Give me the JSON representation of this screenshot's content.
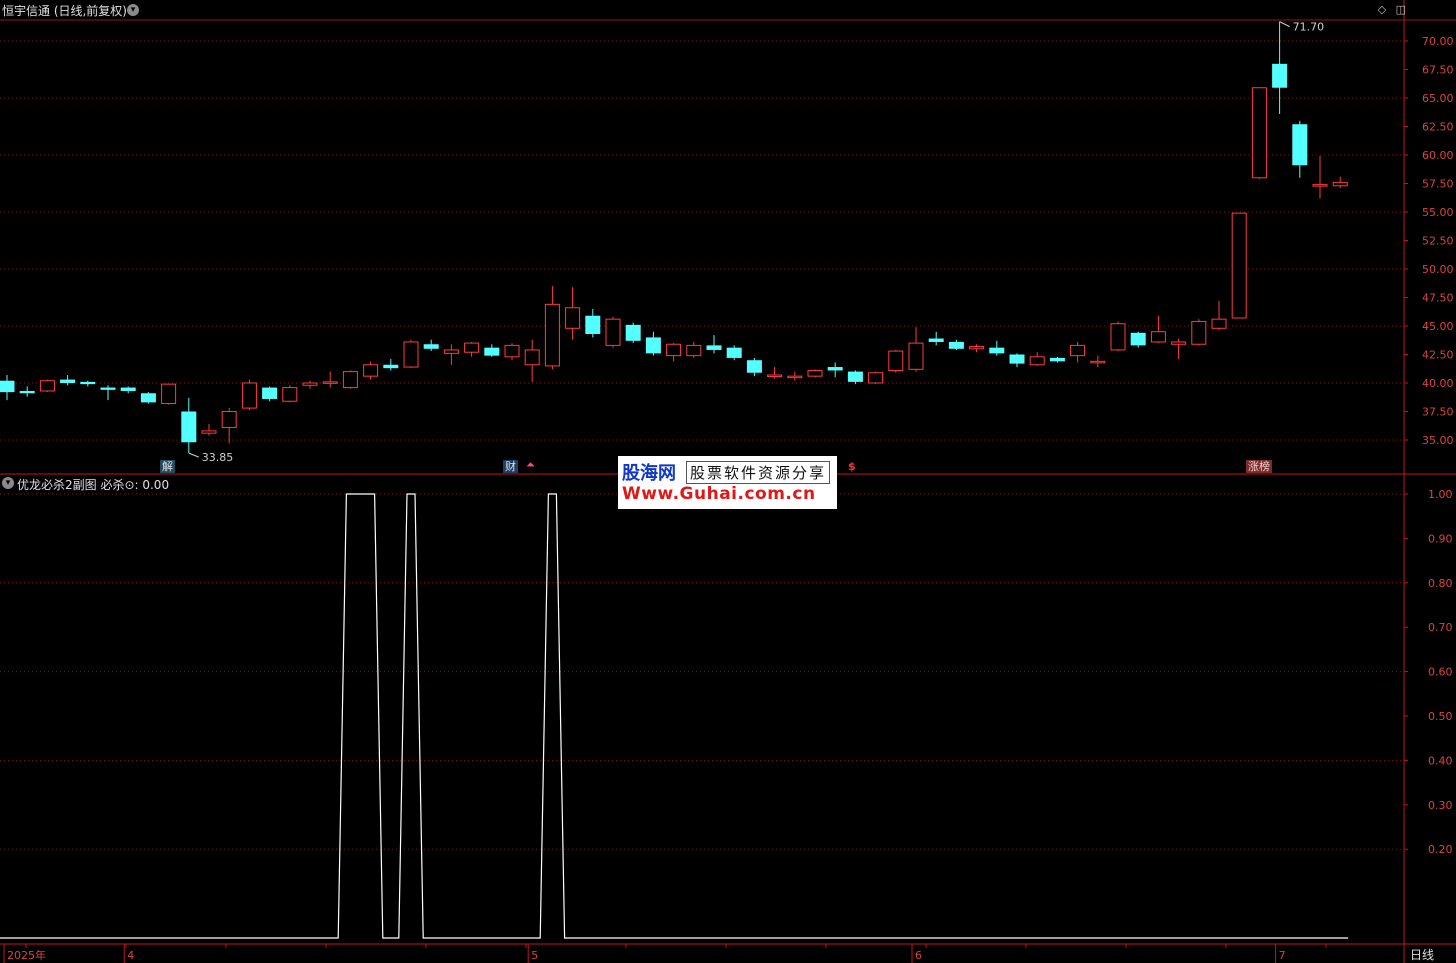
{
  "header": {
    "title": "恒宇信通 (日线,前复权)",
    "dropdown_icon": "chevron-down-icon",
    "window_icons": [
      "◇",
      "◫"
    ]
  },
  "sub_header": {
    "title": "优龙必杀2副图 必杀⊙: 0.00"
  },
  "markers": {
    "jie": "解",
    "cai": "财",
    "up": "⏶",
    "dollar": "$",
    "zhangbang": "涨榜"
  },
  "logo": {
    "line1_cn": "股海网",
    "line1_tag": "股票软件资源分享",
    "line2": "Www.Guhai.com.cn"
  },
  "annotations": {
    "high": "71.70",
    "low": "33.85"
  },
  "price_axis": [
    "70.00",
    "67.50",
    "65.00",
    "62.50",
    "60.00",
    "57.50",
    "55.00",
    "52.50",
    "50.00",
    "47.50",
    "45.00",
    "42.50",
    "40.00",
    "37.50",
    "35.00"
  ],
  "indicator_axis": [
    "1.00",
    "0.90",
    "0.80",
    "0.70",
    "0.60",
    "0.50",
    "0.40",
    "0.30",
    "0.20"
  ],
  "date_axis": [
    {
      "label": "2025年",
      "index": 0
    },
    {
      "label": "4",
      "index": 6
    },
    {
      "label": "5",
      "index": 26
    },
    {
      "label": "6",
      "index": 45
    },
    {
      "label": "7",
      "index": 63
    }
  ],
  "bottom_tab": "日线",
  "colors": {
    "up": "#ff3c3c",
    "down": "#54ffff",
    "grid": "#8a1010",
    "line": "#ffffff"
  },
  "chart_data": {
    "type": "candlestick",
    "price_range": [
      32.5,
      72.0
    ],
    "indicator_range": [
      0.0,
      1.0
    ],
    "candles": [
      [
        40.2,
        39.2,
        40.7,
        38.5
      ],
      [
        39.3,
        39.1,
        39.7,
        38.8
      ],
      [
        39.3,
        40.2,
        40.3,
        39.2
      ],
      [
        40.3,
        40.0,
        40.7,
        39.8
      ],
      [
        40.1,
        39.9,
        40.2,
        39.7
      ],
      [
        39.6,
        39.4,
        39.8,
        38.5
      ],
      [
        39.6,
        39.3,
        39.7,
        39.1
      ],
      [
        39.1,
        38.3,
        39.2,
        38.2
      ],
      [
        38.2,
        39.9,
        39.9,
        38.1
      ],
      [
        37.5,
        34.8,
        38.7,
        33.85
      ],
      [
        35.6,
        35.8,
        36.4,
        35.4
      ],
      [
        36.1,
        37.5,
        37.8,
        34.7
      ],
      [
        37.8,
        40.0,
        40.3,
        37.6
      ],
      [
        39.6,
        38.6,
        39.7,
        38.4
      ],
      [
        38.4,
        39.6,
        39.8,
        38.3
      ],
      [
        39.8,
        40.0,
        40.2,
        39.5
      ],
      [
        40.0,
        40.1,
        41.0,
        39.6
      ],
      [
        39.6,
        41.0,
        41.1,
        39.5
      ],
      [
        40.6,
        41.6,
        41.9,
        40.3
      ],
      [
        41.6,
        41.3,
        42.1,
        41.1
      ],
      [
        41.4,
        43.6,
        43.8,
        41.3
      ],
      [
        43.4,
        43.0,
        43.8,
        42.8
      ],
      [
        42.6,
        42.9,
        43.4,
        41.6
      ],
      [
        42.7,
        43.5,
        43.6,
        42.3
      ],
      [
        43.1,
        42.4,
        43.4,
        42.3
      ],
      [
        42.3,
        43.3,
        43.5,
        42.0
      ],
      [
        41.6,
        42.9,
        43.8,
        40.1
      ],
      [
        41.5,
        46.9,
        48.5,
        41.2
      ],
      [
        44.8,
        46.6,
        48.4,
        43.8
      ],
      [
        45.9,
        44.3,
        46.5,
        44.0
      ],
      [
        43.3,
        45.6,
        45.8,
        43.1
      ],
      [
        45.1,
        43.7,
        45.3,
        43.5
      ],
      [
        44.0,
        42.6,
        44.5,
        42.4
      ],
      [
        42.4,
        43.4,
        43.5,
        41.9
      ],
      [
        42.4,
        43.3,
        43.6,
        42.2
      ],
      [
        43.3,
        42.9,
        44.2,
        42.6
      ],
      [
        43.1,
        42.2,
        43.3,
        42.0
      ],
      [
        42.0,
        40.9,
        42.2,
        40.6
      ],
      [
        40.6,
        40.7,
        41.4,
        40.4
      ],
      [
        40.5,
        40.6,
        41.0,
        40.2
      ],
      [
        40.6,
        41.1,
        41.2,
        40.5
      ],
      [
        41.4,
        41.1,
        41.8,
        40.5
      ],
      [
        41.0,
        40.1,
        41.1,
        39.9
      ],
      [
        40.0,
        40.9,
        41.0,
        39.9
      ],
      [
        41.1,
        42.8,
        42.9,
        40.9
      ],
      [
        41.2,
        43.5,
        44.9,
        41.0
      ],
      [
        43.9,
        43.6,
        44.5,
        43.3
      ],
      [
        43.6,
        43.0,
        43.8,
        42.9
      ],
      [
        43.0,
        43.2,
        43.4,
        42.7
      ],
      [
        43.1,
        42.6,
        43.7,
        42.4
      ],
      [
        42.5,
        41.7,
        42.6,
        41.4
      ],
      [
        41.6,
        42.3,
        42.7,
        41.5
      ],
      [
        42.2,
        41.9,
        42.3,
        41.8
      ],
      [
        42.4,
        43.3,
        43.6,
        41.8
      ],
      [
        41.9,
        41.9,
        42.4,
        41.4
      ],
      [
        42.9,
        45.2,
        45.4,
        42.8
      ],
      [
        44.4,
        43.3,
        44.5,
        43.1
      ],
      [
        43.6,
        44.5,
        45.9,
        43.5
      ],
      [
        43.4,
        43.6,
        43.9,
        42.1
      ],
      [
        43.4,
        45.4,
        45.6,
        43.3
      ],
      [
        44.8,
        45.6,
        47.2,
        44.6
      ],
      [
        45.7,
        54.9,
        54.9,
        45.7
      ],
      [
        58.0,
        65.9,
        65.9,
        57.9
      ],
      [
        68.0,
        65.9,
        71.7,
        63.6
      ],
      [
        62.7,
        59.1,
        63.0,
        58.0
      ],
      [
        57.4,
        57.4,
        59.9,
        56.2
      ],
      [
        57.3,
        57.6,
        58.1,
        57.1
      ]
    ],
    "indicator": {
      "name": "必杀",
      "values": [
        0,
        0,
        0,
        0,
        0,
        0,
        0,
        0,
        0,
        0,
        0,
        0,
        0,
        0,
        0,
        0,
        0,
        1,
        1,
        0,
        1,
        0,
        0,
        0,
        0,
        0,
        0,
        1,
        0,
        0,
        0,
        0,
        0,
        0,
        0,
        0,
        0,
        0,
        0,
        0,
        0,
        0,
        0,
        0,
        0,
        0,
        0,
        0,
        0,
        0,
        0,
        0,
        0,
        0,
        0,
        0,
        0,
        0,
        0,
        0,
        0,
        0,
        0,
        0,
        0,
        0,
        0
      ]
    }
  }
}
